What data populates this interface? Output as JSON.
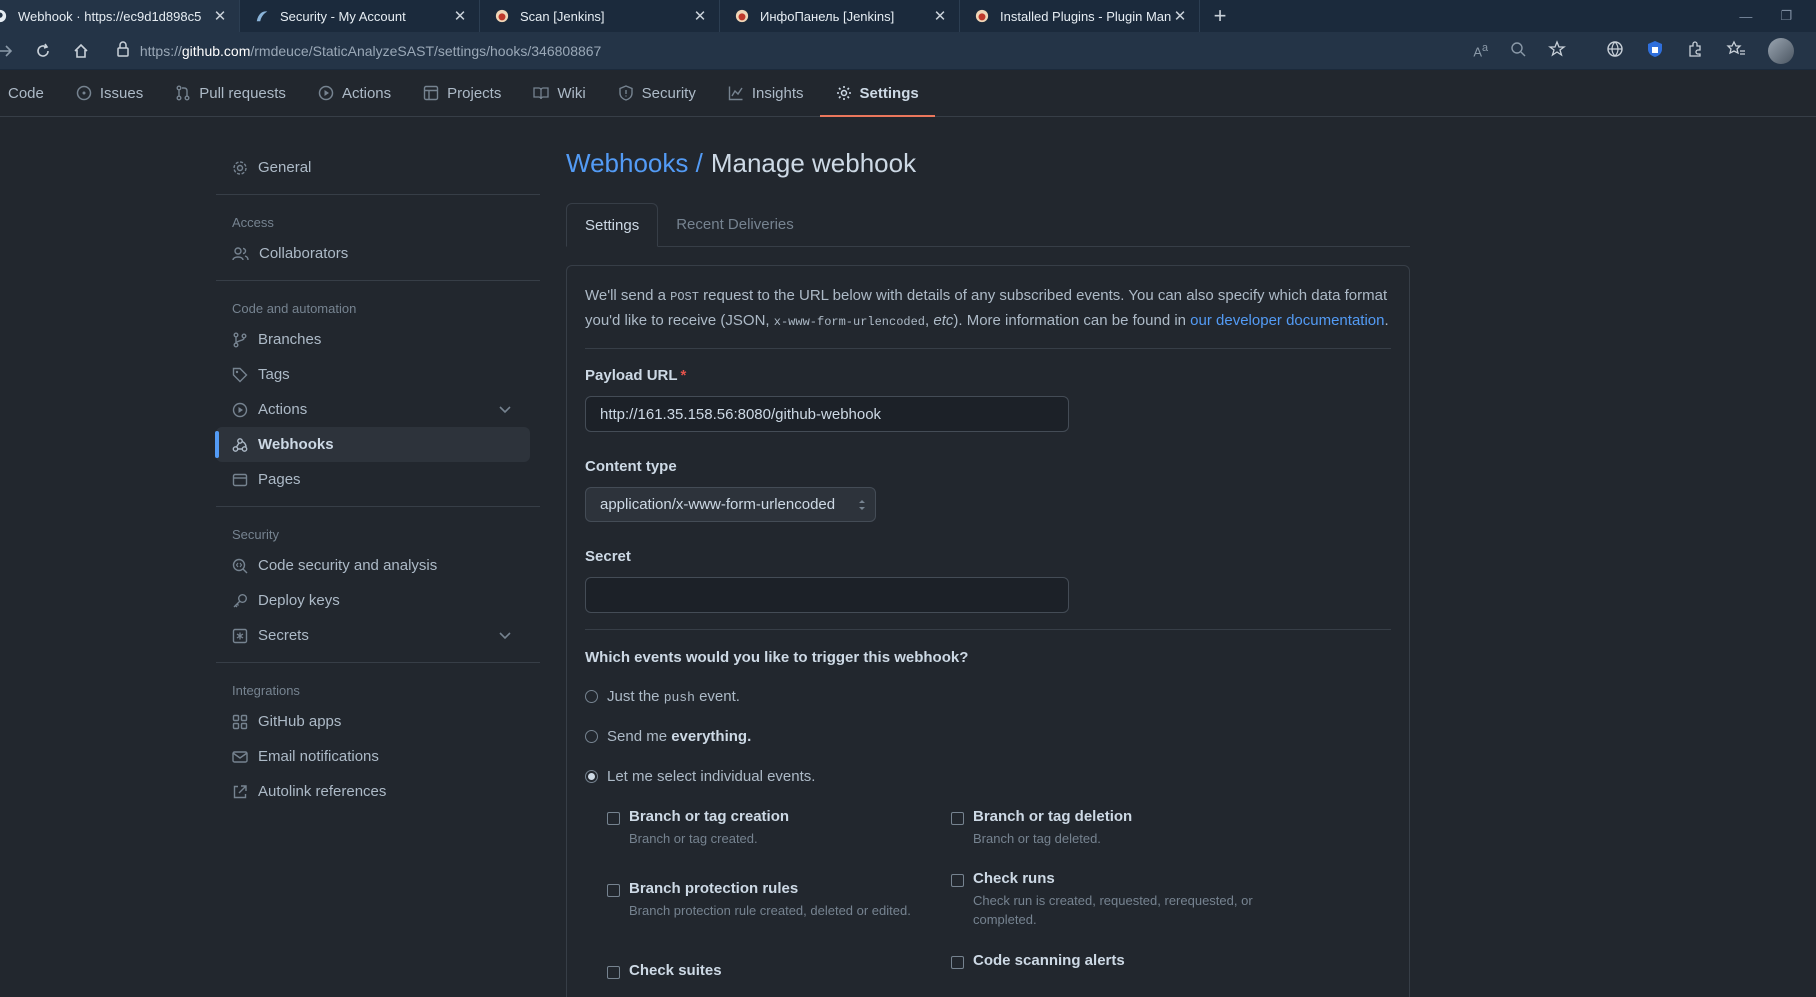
{
  "browser": {
    "tabs": [
      {
        "title": "Webhook · https://ec9d1d898c5",
        "active": true
      },
      {
        "title": "Security - My Account",
        "active": false
      },
      {
        "title": "Scan [Jenkins]",
        "active": false
      },
      {
        "title": "ИнфоПанель [Jenkins]",
        "active": false
      },
      {
        "title": "Installed Plugins - Plugin Manag",
        "active": false
      }
    ],
    "url_prefix": "https://",
    "url_host": "github.com",
    "url_path": "/rmdeuce/StaticAnalyzeSAST/settings/hooks/346808867"
  },
  "repo_nav": {
    "tabs": [
      "Code",
      "Issues",
      "Pull requests",
      "Actions",
      "Projects",
      "Wiki",
      "Security",
      "Insights",
      "Settings"
    ],
    "active": "Settings"
  },
  "sidebar": {
    "general": "General",
    "access_heading": "Access",
    "collaborators": "Collaborators",
    "code_heading": "Code and automation",
    "branches": "Branches",
    "tags": "Tags",
    "actions": "Actions",
    "webhooks": "Webhooks",
    "pages": "Pages",
    "security_heading": "Security",
    "code_security": "Code security and analysis",
    "deploy_keys": "Deploy keys",
    "secrets": "Secrets",
    "integrations_heading": "Integrations",
    "github_apps": "GitHub apps",
    "email_notifications": "Email notifications",
    "autolink": "Autolink references"
  },
  "main": {
    "breadcrumb": "Webhooks /",
    "title": "Manage webhook",
    "tab_settings": "Settings",
    "tab_deliveries": "Recent Deliveries",
    "intro_1": "We'll send a ",
    "intro_post": "POST",
    "intro_2": " request to the URL below with details of any subscribed events. You can also specify which data format you'd like to receive (JSON, ",
    "intro_code": "x-www-form-urlencoded",
    "intro_3": ", ",
    "intro_etc": "etc",
    "intro_4": "). More information can be found in ",
    "intro_link": "our developer documentation",
    "intro_5": ".",
    "payload_label": "Payload URL",
    "payload_required": "*",
    "payload_value": "http://161.35.158.56:8080/github-webhook",
    "content_type_label": "Content type",
    "content_type_value": "application/x-www-form-urlencoded",
    "secret_label": "Secret",
    "secret_value": "",
    "events_question": "Which events would you like to trigger this webhook?",
    "radio_push_1": "Just the ",
    "radio_push_code": "push",
    "radio_push_2": " event.",
    "radio_all_1": "Send me ",
    "radio_all_bold": "everything.",
    "radio_select": "Let me select individual events.",
    "events": [
      {
        "title": "Branch or tag creation",
        "desc": "Branch or tag created."
      },
      {
        "title": "Branch or tag deletion",
        "desc": "Branch or tag deleted."
      },
      {
        "title": "Branch protection rules",
        "desc": "Branch protection rule created, deleted or edited."
      },
      {
        "title": "Check runs",
        "desc": "Check run is created, requested, rerequested, or completed."
      },
      {
        "title": "Check suites",
        "desc": ""
      },
      {
        "title": "Code scanning alerts",
        "desc": ""
      }
    ]
  }
}
